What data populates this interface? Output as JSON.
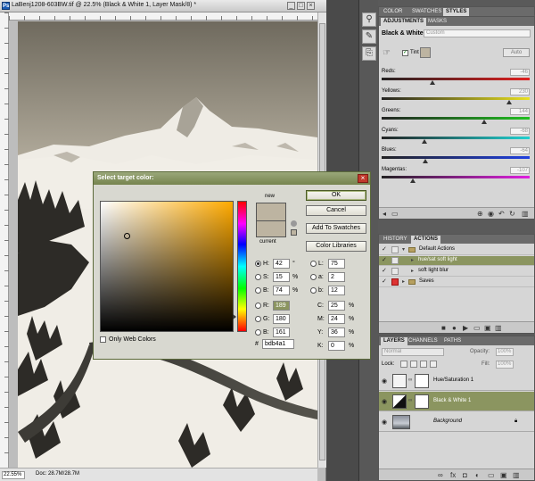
{
  "document": {
    "title": "LaBenj1208-603BW.tif @ 22.5% (Black & White 1, Layer Mask/8) *",
    "zoom": "22.55%",
    "doc_info": "Doc: 28.7M/28.7M"
  },
  "panels": {
    "color_tabs": [
      "COLOR",
      "SWATCHES",
      "STYLES"
    ],
    "adj_tabs": [
      "ADJUSTMENTS",
      "MASKS"
    ],
    "adjustment": {
      "name": "Black & White",
      "preset": "Custom",
      "tint_label": "Tint",
      "auto_label": "Auto",
      "sliders": [
        {
          "label": "Reds:",
          "value": "-46"
        },
        {
          "label": "Yellows:",
          "value": "230"
        },
        {
          "label": "Greens:",
          "value": "144"
        },
        {
          "label": "Cyans:",
          "value": "-68"
        },
        {
          "label": "Blues:",
          "value": "-64"
        },
        {
          "label": "Magentas:",
          "value": "-107"
        }
      ]
    },
    "actions_tabs": [
      "HISTORY",
      "ACTIONS"
    ],
    "actions": [
      {
        "label": "Default Actions"
      },
      {
        "label": "hue/sat soft light"
      },
      {
        "label": "soft light blur"
      },
      {
        "label": "Saves"
      }
    ],
    "layers_tabs": [
      "LAYERS",
      "CHANNELS",
      "PATHS"
    ],
    "layers": {
      "blend_mode": "Normal",
      "opacity_label": "Opacity:",
      "opacity": "100%",
      "lock_label": "Lock:",
      "fill_label": "Fill:",
      "fill": "100%",
      "items": [
        {
          "name": "Hue/Saturation 1"
        },
        {
          "name": "Black & White 1"
        },
        {
          "name": "Background"
        }
      ]
    }
  },
  "color_picker": {
    "title": "Select target color:",
    "new_label": "new",
    "current_label": "current",
    "buttons": {
      "ok": "OK",
      "cancel": "Cancel",
      "add_swatches": "Add To Swatches",
      "libraries": "Color Libraries"
    },
    "fields": {
      "H": {
        "label": "H:",
        "value": "42",
        "unit": "°"
      },
      "S": {
        "label": "S:",
        "value": "15",
        "unit": "%"
      },
      "B": {
        "label": "B:",
        "value": "74",
        "unit": "%"
      },
      "R": {
        "label": "R:",
        "value": "189"
      },
      "G": {
        "label": "G:",
        "value": "180"
      },
      "Bl": {
        "label": "B:",
        "value": "161"
      },
      "L": {
        "label": "L:",
        "value": "75"
      },
      "a": {
        "label": "a:",
        "value": "2"
      },
      "b": {
        "label": "b:",
        "value": "12"
      },
      "C": {
        "label": "C:",
        "value": "25",
        "unit": "%"
      },
      "M": {
        "label": "M:",
        "value": "24",
        "unit": "%"
      },
      "Y": {
        "label": "Y:",
        "value": "36",
        "unit": "%"
      },
      "K": {
        "label": "K:",
        "value": "0",
        "unit": "%"
      }
    },
    "hex_label": "#",
    "hex": "bdb4a1",
    "web_only_label": "Only Web Colors"
  },
  "colors": {
    "target": "#bdb4a1",
    "selection": "#8b9560"
  }
}
